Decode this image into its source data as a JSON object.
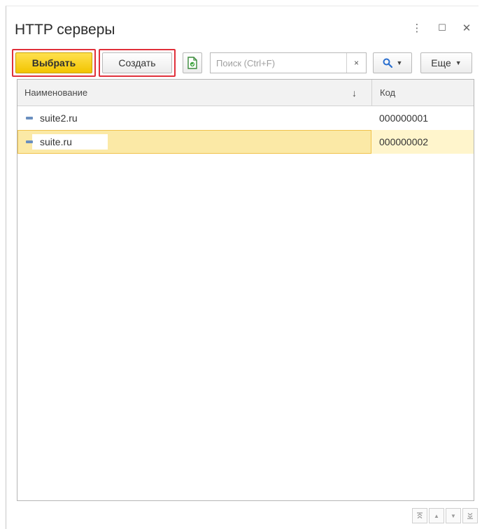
{
  "window": {
    "title": "HTTP серверы",
    "menu_icon": "⋮",
    "maximize_icon": "☐",
    "close_icon": "✕"
  },
  "toolbar": {
    "select_label": "Выбрать",
    "create_label": "Создать",
    "search_placeholder": "Поиск (Ctrl+F)",
    "search_value": "",
    "clear_icon": "×",
    "search_icon": "🔍",
    "more_label": "Еще"
  },
  "table": {
    "columns": [
      "Наименование",
      "Код"
    ],
    "sort_indicator": "↓",
    "rows": [
      {
        "name": "suite2.ru",
        "code": "000000001",
        "selected": false
      },
      {
        "name": "suite.ru",
        "code": "000000002",
        "selected": true
      }
    ]
  },
  "nav": {
    "first": "⏫",
    "prev": "▲",
    "next": "▼",
    "last": "⏬"
  },
  "colors": {
    "primary_button": "#f2c400",
    "highlight_frame": "#e0303a",
    "selected_row": "#fbe9a6",
    "selected_border": "#f0c24a",
    "item_icon": "#6a8fbf"
  }
}
